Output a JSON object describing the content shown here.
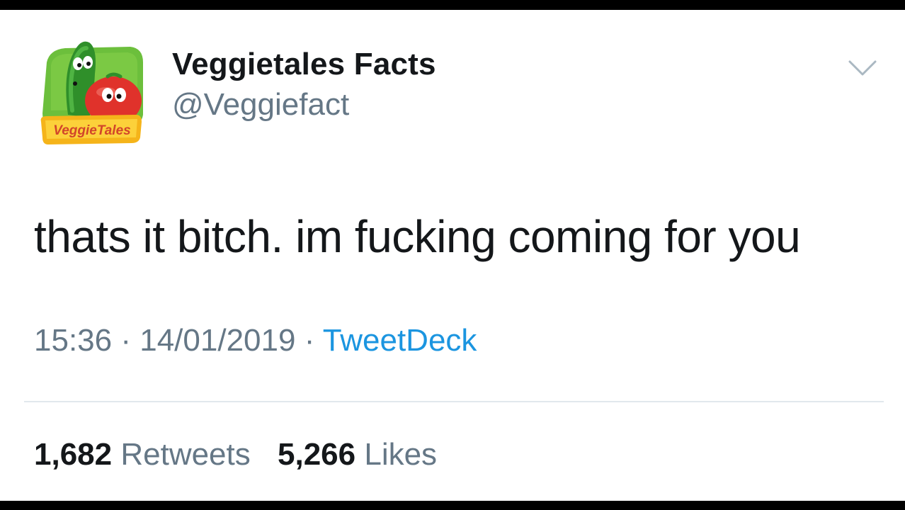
{
  "user": {
    "display_name": "Veggietales Facts",
    "handle": "@Veggiefact",
    "avatar_logo_text": "VeggieTales",
    "avatar_icon": "veggietales-logo-avatar"
  },
  "tweet": {
    "text": "thats it bitch. im fucking coming for you",
    "time": "15:36",
    "separator": "·",
    "date": "14/01/2019",
    "source": "TweetDeck"
  },
  "stats": {
    "retweets_count": "1,682",
    "retweets_label": "Retweets",
    "likes_count": "5,266",
    "likes_label": "Likes"
  },
  "icons": {
    "menu": "chevron-down-icon"
  },
  "colors": {
    "text_primary": "#14171a",
    "text_secondary": "#657786",
    "link": "#1b95e0",
    "divider": "#e1e8ed"
  }
}
